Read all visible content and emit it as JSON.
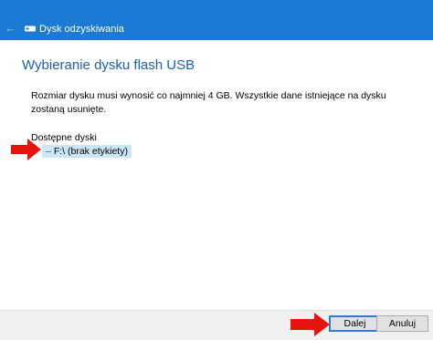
{
  "window": {
    "title": "Dysk odzyskiwania",
    "back_icon": "back-arrow-icon",
    "drive_icon": "usb-drive-icon"
  },
  "main": {
    "heading": "Wybieranie dysku flash USB",
    "description": "Rozmiar dysku musi wynosić co najmniej 4 GB. Wszystkie dane istniejące na dysku zostaną usunięte.",
    "drives_label": "Dostępne dyski",
    "drives": [
      {
        "label": "F:\\ (brak etykiety)",
        "selected": true
      }
    ]
  },
  "footer": {
    "next_label": "Dalej",
    "cancel_label": "Anuluj"
  },
  "colors": {
    "titlebar": "#1a7ad4",
    "heading": "#1c5fb0",
    "selection": "#cde6f7",
    "annotation_arrow": "#e8130e"
  }
}
